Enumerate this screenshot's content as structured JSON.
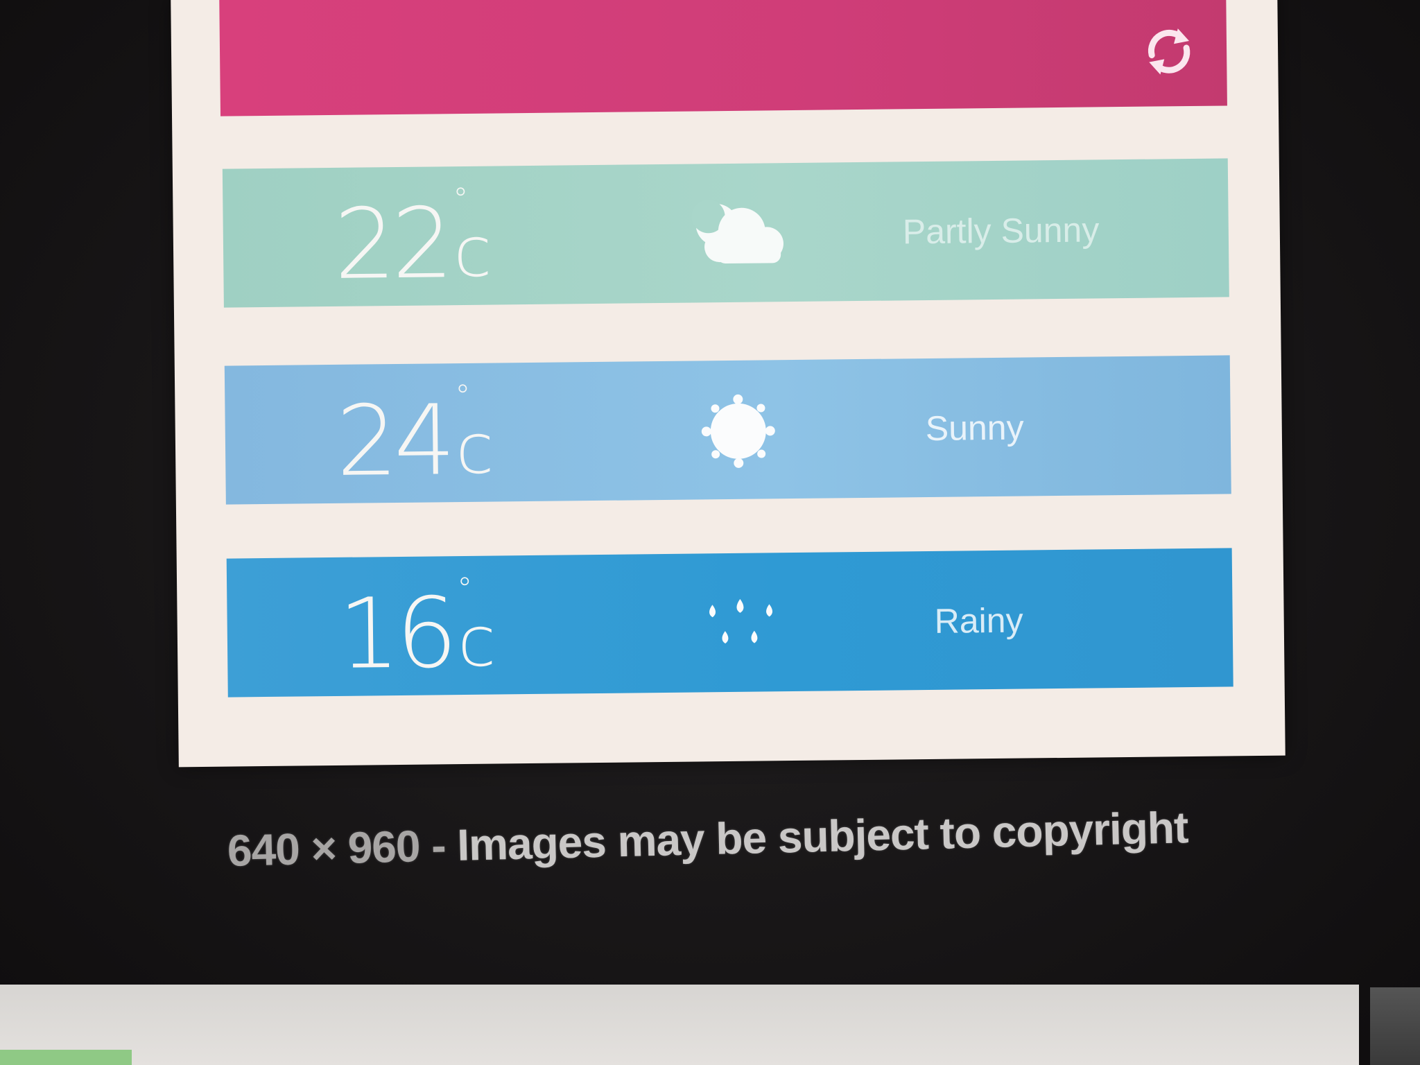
{
  "forecast": {
    "rows": [
      {
        "temp": "22",
        "deg": "°",
        "unit": "c",
        "condition": "Partly Sunny",
        "icon": "partly-sunny-icon"
      },
      {
        "temp": "24",
        "deg": "°",
        "unit": "c",
        "condition": "Sunny",
        "icon": "sun-icon"
      },
      {
        "temp": "16",
        "deg": "°",
        "unit": "c",
        "condition": "Rainy",
        "icon": "rain-icon"
      }
    ]
  },
  "hero": {
    "icon": "refresh-icon"
  },
  "caption": {
    "dims": "640 × 960 - ",
    "text": "Images may be subject to copyright"
  },
  "colors": {
    "hero": "#d8407c",
    "partly": "#a9d6ca",
    "sunny": "#8ec3e6",
    "rainy": "#2f9ad4",
    "card": "#f4ece6",
    "background": "#1a1819"
  }
}
